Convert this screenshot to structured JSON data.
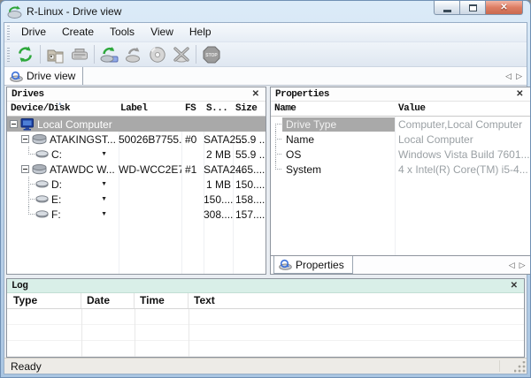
{
  "window": {
    "title": "R-Linux - Drive view",
    "status": "Ready"
  },
  "menu": {
    "items": [
      "Drive",
      "Create",
      "Tools",
      "View",
      "Help"
    ]
  },
  "toolbar": {
    "stop_label": "STOP",
    "buttons": [
      {
        "name": "refresh",
        "enabled": true
      },
      {
        "name": "open-drive-image",
        "enabled": true
      },
      {
        "name": "connect-to-remote",
        "enabled": false
      },
      {
        "name": "scan-drive",
        "enabled": true
      },
      {
        "name": "create-image",
        "enabled": false
      },
      {
        "name": "open-drive-files",
        "enabled": false
      },
      {
        "name": "remove-device",
        "enabled": false
      },
      {
        "name": "stop",
        "enabled": false
      }
    ]
  },
  "tabs": {
    "drive_view": "Drive view"
  },
  "drives": {
    "title": "Drives",
    "columns": [
      "Device/Disk",
      "Label",
      "FS",
      "S...",
      "Size"
    ],
    "rows": [
      {
        "device": "Local Computer",
        "label": "",
        "fs": "",
        "s": "",
        "size": ""
      },
      {
        "device": "ATAKINGST...",
        "label": "50026B7755...",
        "fs": "#0",
        "s": "SATA2...",
        "size": "55.9 ..."
      },
      {
        "device": "C:",
        "label": "",
        "fs": "",
        "s": "2 MB",
        "size": "55.9 ..."
      },
      {
        "device": "ATAWDC W...",
        "label": "WD-WCC2E7...",
        "fs": "#1",
        "s": "SATA2...",
        "size": "465...."
      },
      {
        "device": "D:",
        "label": "",
        "fs": "",
        "s": "1 MB",
        "size": "150...."
      },
      {
        "device": "E:",
        "label": "",
        "fs": "",
        "s": "150....",
        "size": "158...."
      },
      {
        "device": "F:",
        "label": "",
        "fs": "",
        "s": "308....",
        "size": "157...."
      }
    ]
  },
  "properties": {
    "title": "Properties",
    "tab_label": "Properties",
    "columns": [
      "Name",
      "Value"
    ],
    "rows": [
      {
        "name": "Drive Type",
        "value": "Computer,Local Computer"
      },
      {
        "name": "Name",
        "value": "Local Computer"
      },
      {
        "name": "OS",
        "value": "Windows Vista Build 7601..."
      },
      {
        "name": "System",
        "value": "4 x Intel(R) Core(TM) i5-4..."
      }
    ]
  },
  "log": {
    "title": "Log",
    "columns": [
      "Type",
      "Date",
      "Time",
      "Text"
    ]
  },
  "colors": {
    "selection_gray": "#a9a9a9",
    "value_text_gray": "#9aa0a4",
    "log_header_green": "#d9efe8",
    "accent_green": "#2ea83c",
    "close_button_red": "#c96a50",
    "titlebar_blue": "#b9d1e9"
  }
}
